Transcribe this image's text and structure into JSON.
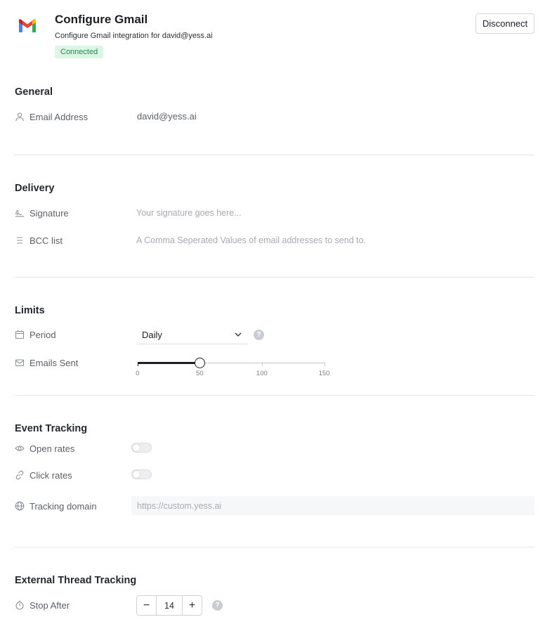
{
  "header": {
    "title": "Configure Gmail",
    "subtitle": "Configure Gmail integration for david@yess.ai",
    "status_badge": "Connected",
    "disconnect_label": "Disconnect",
    "logo_icon": "gmail-logo"
  },
  "general": {
    "title": "General",
    "email_label": "Email Address",
    "email_value": "david@yess.ai"
  },
  "delivery": {
    "title": "Delivery",
    "signature_label": "Signature",
    "signature_placeholder": "Your signature goes here...",
    "bcc_label": "BCC list",
    "bcc_placeholder": "A Comma Seperated Values of email addresses to send to."
  },
  "limits": {
    "title": "Limits",
    "period_label": "Period",
    "period_value": "Daily",
    "emails_sent_label": "Emails Sent",
    "slider": {
      "min": 0,
      "max": 150,
      "value": 50,
      "ticks": [
        "0",
        "50",
        "100",
        "150"
      ]
    }
  },
  "event_tracking": {
    "title": "Event Tracking",
    "open_rates_label": "Open rates",
    "open_rates_enabled": false,
    "click_rates_label": "Click rates",
    "click_rates_enabled": false,
    "tracking_domain_label": "Tracking domain",
    "tracking_domain_placeholder": "https://custom.yess.ai"
  },
  "external_thread_tracking": {
    "title": "External Thread Tracking",
    "stop_after_label": "Stop After",
    "stop_after_value": "14",
    "decrement_symbol": "−",
    "increment_symbol": "+"
  },
  "help_symbol": "?",
  "colors": {
    "badge_text": "#1f8a4c",
    "badge_bg": "#dcf5e5",
    "gmail_red": "#EA4335",
    "gmail_blue": "#4285F4",
    "gmail_green": "#34A853",
    "gmail_yellow": "#FBBC04"
  }
}
